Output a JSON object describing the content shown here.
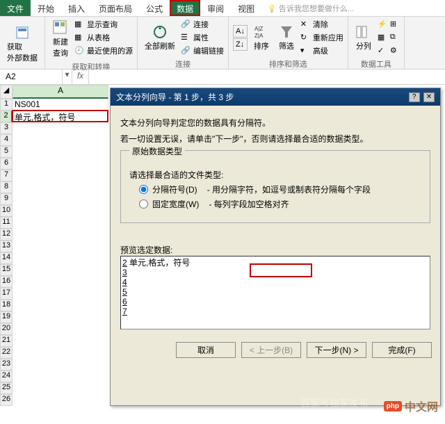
{
  "tabs": {
    "file": "文件",
    "home": "开始",
    "insert": "插入",
    "layout": "页面布局",
    "formulas": "公式",
    "data": "数据",
    "review": "审阅",
    "view": "视图",
    "tellme": "告诉我您想要做什么..."
  },
  "ribbon": {
    "get_ext": "获取\n外部数据",
    "new_query": "新建\n查询",
    "show_query": "显示查询",
    "from_table": "从表格",
    "recent": "最近使用的源",
    "group_get": "获取和转换",
    "refresh_all": "全部刷新",
    "connections": "连接",
    "properties": "属性",
    "edit_links": "编辑链接",
    "group_conn": "连接",
    "sort_az": "A↓Z",
    "sort_za": "Z↓A",
    "sort": "排序",
    "filter": "筛选",
    "clear": "清除",
    "reapply": "重新应用",
    "advanced": "高级",
    "group_sort": "排序和筛选",
    "text_to_col": "分列",
    "group_tools": "数据工具"
  },
  "namebox": "A2",
  "grid": {
    "colA": "A",
    "r1": "NS001",
    "r2": "单元,格式，符号"
  },
  "wizard": {
    "title": "文本分列向导 - 第 1 步，共 3 步",
    "line1": "文本分列向导判定您的数据具有分隔符。",
    "line2": "若一切设置无误，请单击\"下一步\"，否则请选择最合适的数据类型。",
    "fieldset_title": "原始数据类型",
    "choose": "请选择最合适的文件类型:",
    "opt1_label": "分隔符号(D)",
    "opt1_desc": "- 用分隔字符，如逗号或制表符分隔每个字段",
    "opt2_label": "固定宽度(W)",
    "opt2_desc": "- 每列字段加空格对齐",
    "preview_title": "预览选定数据:",
    "preview_lines": [
      "单元,格式，符号",
      "",
      "",
      "",
      "",
      ""
    ],
    "btn_cancel": "取消",
    "btn_back": "< 上一步(B)",
    "btn_next": "下一步(N) >",
    "btn_finish": "完成(F)"
  },
  "watermark": "中文网",
  "watermark2": "百家号独家发布"
}
